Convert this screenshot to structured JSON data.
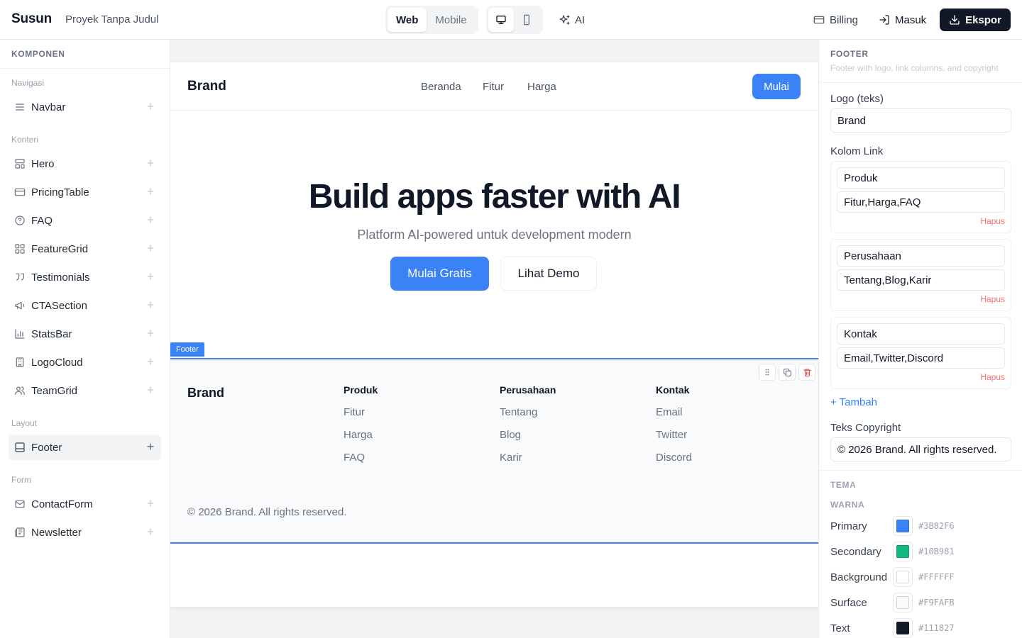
{
  "topbar": {
    "app_name": "Susun",
    "project_name": "Proyek Tanpa Judul",
    "view_modes": [
      "Web",
      "Mobile"
    ],
    "active_view": "Web",
    "device_icons": [
      "monitor-icon",
      "phone-icon"
    ],
    "active_device": "monitor-icon",
    "ai_label": "AI",
    "billing_label": "Billing",
    "login_label": "Masuk",
    "export_label": "Ekspor"
  },
  "sidebar": {
    "title": "KOMPONEN",
    "groups": [
      {
        "label": "Navigasi",
        "items": [
          {
            "label": "Navbar",
            "icon": "menu-icon"
          }
        ]
      },
      {
        "label": "Konten",
        "items": [
          {
            "label": "Hero",
            "icon": "layout-icon"
          },
          {
            "label": "PricingTable",
            "icon": "credit-card-icon"
          },
          {
            "label": "FAQ",
            "icon": "help-circle-icon"
          },
          {
            "label": "FeatureGrid",
            "icon": "grid-icon"
          },
          {
            "label": "Testimonials",
            "icon": "quote-icon"
          },
          {
            "label": "CTASection",
            "icon": "megaphone-icon"
          },
          {
            "label": "StatsBar",
            "icon": "bar-chart-icon"
          },
          {
            "label": "LogoCloud",
            "icon": "building-icon"
          },
          {
            "label": "TeamGrid",
            "icon": "users-icon"
          }
        ]
      },
      {
        "label": "Layout",
        "items": [
          {
            "label": "Footer",
            "icon": "panel-bottom-icon",
            "active": true
          }
        ]
      },
      {
        "label": "Form",
        "items": [
          {
            "label": "ContactForm",
            "icon": "mail-icon"
          },
          {
            "label": "Newsletter",
            "icon": "newspaper-icon"
          }
        ]
      }
    ]
  },
  "preview": {
    "navbar": {
      "brand": "Brand",
      "links": [
        "Beranda",
        "Fitur",
        "Harga"
      ],
      "cta": "Mulai"
    },
    "hero": {
      "title": "Build apps faster with AI",
      "subtitle": "Platform AI-powered untuk development modern",
      "primary_cta": "Mulai Gratis",
      "secondary_cta": "Lihat Demo"
    },
    "selected_tag": "Footer",
    "footer": {
      "brand": "Brand",
      "columns": [
        {
          "title": "Produk",
          "links": [
            "Fitur",
            "Harga",
            "FAQ"
          ]
        },
        {
          "title": "Perusahaan",
          "links": [
            "Tentang",
            "Blog",
            "Karir"
          ]
        },
        {
          "title": "Kontak",
          "links": [
            "Email",
            "Twitter",
            "Discord"
          ]
        }
      ],
      "copyright": "© 2026 Brand. All rights reserved."
    }
  },
  "panel": {
    "title": "FOOTER",
    "description": "Footer with logo, link columns, and copyright",
    "logo_label": "Logo (teks)",
    "logo_value": "Brand",
    "columns_label": "Kolom Link",
    "link_columns": [
      {
        "title": "Produk",
        "links": "Fitur,Harga,FAQ"
      },
      {
        "title": "Perusahaan",
        "links": "Tentang,Blog,Karir"
      },
      {
        "title": "Kontak",
        "links": "Email,Twitter,Discord"
      }
    ],
    "delete_label": "Hapus",
    "add_label": "+ Tambah",
    "copyright_label": "Teks Copyright",
    "copyright_value": "© 2026 Brand. All rights reserved.",
    "theme_title": "TEMA",
    "colors_title": "WARNA",
    "colors": [
      {
        "name": "Primary",
        "hex": "#3B82F6"
      },
      {
        "name": "Secondary",
        "hex": "#10B981"
      },
      {
        "name": "Background",
        "hex": "#FFFFFF"
      },
      {
        "name": "Surface",
        "hex": "#F9FAFB"
      },
      {
        "name": "Text",
        "hex": "#111827"
      }
    ]
  }
}
